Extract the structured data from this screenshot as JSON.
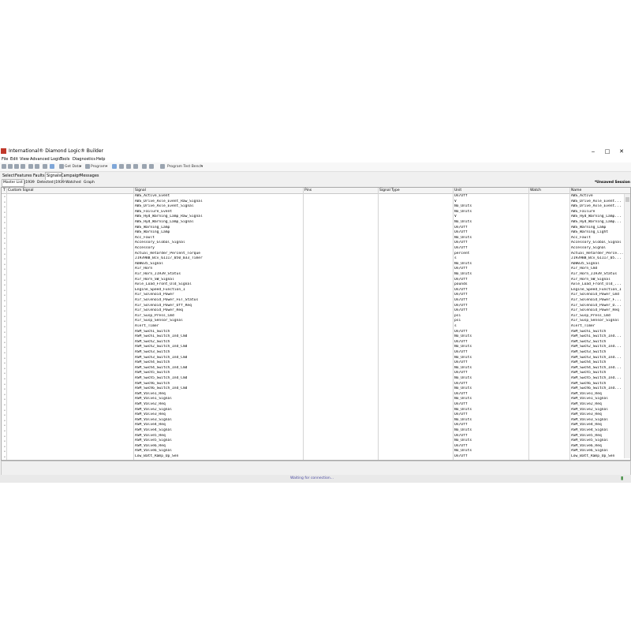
{
  "window": {
    "title": "International® Diamond Logic® Builder",
    "minimize": "‒",
    "maximize": "□",
    "close": "✕"
  },
  "menu": [
    "File",
    "Edit",
    "View",
    "Advanced Logic",
    "Tools",
    "Diagnostics",
    "Help"
  ],
  "toolbar": {
    "get_data": "Get Data",
    "program": "Program",
    "program_test_bench": "Program Test Bench"
  },
  "tabs": [
    "Select",
    "Features",
    "Faults",
    "Signals",
    "Campaign",
    "Messages"
  ],
  "active_tab": "Signals",
  "subtabs": [
    "Master List",
    "J1939",
    "Detected J1939",
    "Watched",
    "Graph"
  ],
  "active_subtab": "Master List",
  "session_status": "*Unsaved Session",
  "columns": [
    "T",
    "Custom Signal",
    "Signal",
    "Pins",
    "Signal Type",
    "Unit",
    "Watch",
    "Name"
  ],
  "rows": [
    {
      "signal": "ABS_Active_Event",
      "unit": "On/Off",
      "name": "ABS_Active"
    },
    {
      "signal": "ABS_Drive_Axle_Event_Raw_Signal",
      "unit": "V",
      "name": "ABS_Drive_Axle_Event..."
    },
    {
      "signal": "ABS_Drive_Axle_Event_Signal",
      "unit": "No_Units",
      "name": "ABS_Drive_Axle_Event..."
    },
    {
      "signal": "ABS_Failure_Event",
      "unit": "No_Units",
      "name": "ABS_Failure"
    },
    {
      "signal": "ABS_Hyd_Warning_Lamp_Raw_Signal",
      "unit": "V",
      "name": "ABS_Hyd_Warning_Lamp..."
    },
    {
      "signal": "ABS_Hyd_Warning_Lamp_Signal",
      "unit": "No_Units",
      "name": "ABS_Hyd_Warning_Lamp..."
    },
    {
      "signal": "ABS_Warning_Lamp",
      "unit": "On/Off",
      "name": "ABS_Warning_Lamp"
    },
    {
      "signal": "ABS_Warning_Lamp",
      "unit": "On/Off",
      "name": "ABS_Warning_Light"
    },
    {
      "signal": "Acc_Fault",
      "unit": "No_Units",
      "name": "Acc_Fault"
    },
    {
      "signal": "Accessory_Global_Signal",
      "unit": "On/Off",
      "name": "Accessory_Global_Signal"
    },
    {
      "signal": "Accessory",
      "unit": "On/Off",
      "name": "Accessory_Signal"
    },
    {
      "signal": "Actual_Retarder_Percent_Torque",
      "unit": "percent",
      "name": "Actual_Retarder_Perce..."
    },
    {
      "signal": "J1939BB_Bcv_61117_050_033_Timer",
      "unit": "s",
      "name": "J1939BB_Bcv_61117_05..."
    },
    {
      "signal": "ADB035_Signal",
      "unit": "No_Units",
      "name": "ADB035_Signal"
    },
    {
      "signal": "Air_Horn",
      "unit": "On/Off",
      "name": "Air_Horn_Cmd"
    },
    {
      "signal": "Air_Horn_J1939_Status",
      "unit": "No_Units",
      "name": "Air_Horn_J1939_Status"
    },
    {
      "signal": "Air_Horn_SW_Signal",
      "unit": "On/Off",
      "name": "Air_Horn_SW_Signal"
    },
    {
      "signal": "Axle_Load_Front_Old_Signal",
      "unit": "pounds",
      "name": "Axle_Load_Front_Old_..."
    },
    {
      "signal": "Engine_Speed_Function_1",
      "unit": "On/Off",
      "name": "Engine_Speed_Function_1"
    },
    {
      "signal": "Air_Solenoid_Power",
      "unit": "On/Off",
      "name": "Air_Solenoid_Power_Cmd"
    },
    {
      "signal": "Air_Solenoid_Power_FET_Status",
      "unit": "On/Off",
      "name": "Air_Solenoid_Power_F..."
    },
    {
      "signal": "Air_Solenoid_Power_Off_Req",
      "unit": "On/Off",
      "name": "Air_Solenoid_Power_O..."
    },
    {
      "signal": "Air_Solenoid_Power_Req",
      "unit": "On/Off",
      "name": "Air_Solenoid_Power_Req"
    },
    {
      "signal": "Air_Susp_Press_Cmd",
      "unit": "psi",
      "name": "Air_Susp_Press_Cmd"
    },
    {
      "signal": "Air_Susp_Sensor_Signal",
      "unit": "psi",
      "name": "Air_Susp_Sensor_Signal"
    },
    {
      "signal": "Alert_Timer",
      "unit": "s",
      "name": "Alert_Timer"
    },
    {
      "signal": "ASM_Swch1_Switch",
      "unit": "On/Off",
      "name": "ASM_Swch1_Switch"
    },
    {
      "signal": "ASM_Swch1_Switch_Ind_Cmd",
      "unit": "No_Units",
      "name": "ASM_Swch1_Switch_Ind..."
    },
    {
      "signal": "ASM_Swch2_Switch",
      "unit": "On/Off",
      "name": "ASM_Swch2_Switch"
    },
    {
      "signal": "ASM_Swch2_Switch_Ind_Cmd",
      "unit": "No_Units",
      "name": "ASM_Swch2_Switch_Ind..."
    },
    {
      "signal": "ASM_Swch3_Switch",
      "unit": "On/Off",
      "name": "ASM_Swch3_Switch"
    },
    {
      "signal": "ASM_Swch3_Switch_Ind_Cmd",
      "unit": "No_Units",
      "name": "ASM_Swch3_Switch_Ind..."
    },
    {
      "signal": "ASM_Swch4_Switch",
      "unit": "On/Off",
      "name": "ASM_Swch4_Switch"
    },
    {
      "signal": "ASM_Swch4_Switch_Ind_Cmd",
      "unit": "No_Units",
      "name": "ASM_Swch4_Switch_Ind..."
    },
    {
      "signal": "ASM_Swch5_Switch",
      "unit": "On/Off",
      "name": "ASM_Swch5_Switch"
    },
    {
      "signal": "ASM_Swch5_Switch_Ind_Cmd",
      "unit": "No_Units",
      "name": "ASM_Swch5_Switch_Ind..."
    },
    {
      "signal": "ASM_Swch6_Switch",
      "unit": "On/Off",
      "name": "ASM_Swch6_Switch"
    },
    {
      "signal": "ASM_Swch6_Switch_Ind_Cmd",
      "unit": "No_Units",
      "name": "ASM_Swch6_Switch_Ind..."
    },
    {
      "signal": "ASM_Valve1_Req",
      "unit": "On/Off",
      "name": "ASM_Valve1_Req"
    },
    {
      "signal": "ASM_Valve1_Signal",
      "unit": "No_Units",
      "name": "ASM_Valve1_Signal"
    },
    {
      "signal": "ASM_Valve2_Req",
      "unit": "On/Off",
      "name": "ASM_Valve2_Req"
    },
    {
      "signal": "ASM_Valve2_Signal",
      "unit": "No_Units",
      "name": "ASM_Valve2_Signal"
    },
    {
      "signal": "ASM_Valve3_Req",
      "unit": "On/Off",
      "name": "ASM_Valve3_Req"
    },
    {
      "signal": "ASM_Valve3_Signal",
      "unit": "No_Units",
      "name": "ASM_Valve3_Signal"
    },
    {
      "signal": "ASM_Valve4_Req",
      "unit": "On/Off",
      "name": "ASM_Valve4_Req"
    },
    {
      "signal": "ASM_Valve4_Signal",
      "unit": "No_Units",
      "name": "ASM_Valve4_Signal"
    },
    {
      "signal": "ASM_Valve5_Req",
      "unit": "On/Off",
      "name": "ASM_Valve5_Req"
    },
    {
      "signal": "ASM_Valve5_Signal",
      "unit": "No_Units",
      "name": "ASM_Valve5_Signal"
    },
    {
      "signal": "ASM_Valve6_Req",
      "unit": "On/Off",
      "name": "ASM_Valve6_Req"
    },
    {
      "signal": "ASM_Valve6_Signal",
      "unit": "No_Units",
      "name": "ASM_Valve6_Signal"
    },
    {
      "signal": "Low_Batt_Ramp_Up_Sen",
      "unit": "On/Off",
      "name": "Low_Batt_Ramp_Up_Sen"
    }
  ],
  "watch_glyph": "⌄",
  "status_text": "Waiting for connection...",
  "signal_icon": "signal-bars-icon"
}
